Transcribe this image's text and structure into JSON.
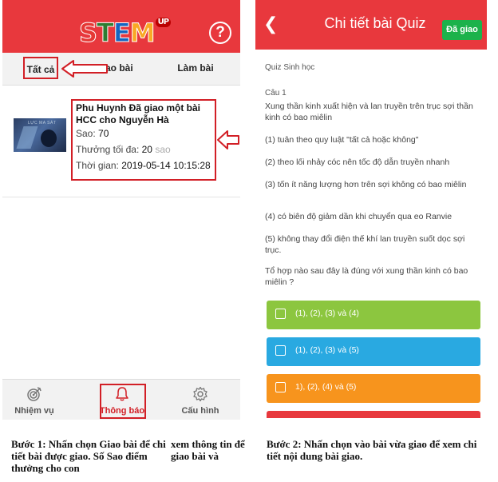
{
  "left_screen": {
    "logo": {
      "parts": [
        "S",
        "T",
        "E",
        "M"
      ],
      "badge": "UP",
      "colors": [
        "#e53935",
        "#2e7d32",
        "#1565c0",
        "#f9a825"
      ]
    },
    "help_icon": "help-circle-icon",
    "tabs": [
      {
        "label": "Tất cả",
        "active": true
      },
      {
        "label": "Giao bài",
        "active": false
      },
      {
        "label": "Làm bài",
        "active": false
      }
    ],
    "notification": {
      "thumbnail_label": "LỰC MA SÁT",
      "title": "Phu Huynh Đã giao một bài HCC cho Nguyễn Hà",
      "stars_label": "Sao:",
      "stars_value": "70",
      "reward_label": "Thưởng tối đa:",
      "reward_value": "20",
      "reward_unit": "sao",
      "time_label": "Thời gian:",
      "time_value": "2019-05-14 10:15:28"
    },
    "bottom_nav": [
      {
        "label": "Nhiệm vụ",
        "icon": "target-icon"
      },
      {
        "label": "Thông báo",
        "icon": "bell-icon",
        "active": true
      },
      {
        "label": "Cấu hình",
        "icon": "gear-icon"
      }
    ]
  },
  "right_screen": {
    "back_icon": "chevron-left-icon",
    "title": "Chi tiết bài Quiz",
    "assigned_button": "Đã giao",
    "subject": "Quiz Sinh học",
    "question_number": "Câu 1",
    "question_stem": "Xung thần kinh xuất hiện và lan truyền trên trục sợi thần kinh có bao miêlin",
    "statements": [
      "(1) tuân theo quy luật \"tất cả hoặc không\"",
      "(2) theo lối nhảy cóc nên tốc độ dẫn truyền nhanh",
      "(3) tốn ít năng lượng hơn trên sợi không có bao miêlin",
      "(4) có biên độ giảm dần khi chuyển qua eo Ranvie",
      "(5) không thay đổi điện thế khí lan truyền suốt dọc sợi trục."
    ],
    "question_ask": "Tổ hợp nào sau đây là đúng với xung thần kinh có bao miêlin ?",
    "answers": [
      {
        "label": "(1), (2), (3) và (4)",
        "color": "#8cc63f"
      },
      {
        "label": "(1), (2), (3) và (5)",
        "color": "#29a9e1"
      },
      {
        "label": "1), (2), (4) và (5)",
        "color": "#f7941d"
      },
      {
        "label": "",
        "color": "#e8383d"
      }
    ]
  },
  "captions": {
    "step1_left": "Bước 1: Nhấn chọn Giao bài để chi tiết bài được giao. Số Sao điểm thưởng cho con",
    "step1_right": "xem thông tin để giao bài và",
    "step2": "Bước 2: Nhấn chọn vào bài vừa giao để xem chi tiết nội dung bài giao."
  },
  "colors": {
    "primary_red": "#e8383d",
    "highlight_red": "#d21f26",
    "green_button": "#1cb24b"
  }
}
